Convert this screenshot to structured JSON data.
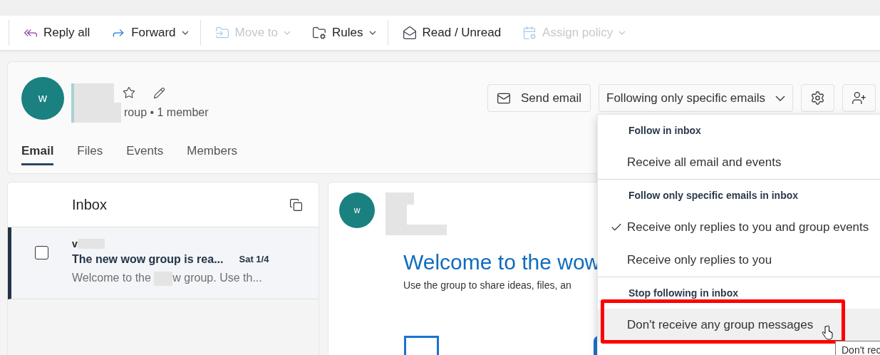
{
  "toolbar": [
    {
      "kind": "reply_all",
      "label": "Reply all",
      "disabled": false,
      "has_menu": false
    },
    {
      "kind": "forward",
      "label": "Forward",
      "disabled": false,
      "has_menu": true
    },
    {
      "kind": "move",
      "label": "Move to",
      "disabled": true,
      "has_menu": true
    },
    {
      "kind": "rules",
      "label": "Rules",
      "disabled": false,
      "has_menu": true
    },
    {
      "kind": "read",
      "label": "Read / Unread",
      "disabled": false,
      "has_menu": false
    },
    {
      "kind": "policy",
      "label": "Assign policy",
      "disabled": true,
      "has_menu": true
    }
  ],
  "group": {
    "avatar": "w",
    "meta": "roup • 1 member",
    "send_button": "Send email",
    "follow_button": "Following only specific emails",
    "tabs": [
      {
        "label": "Email",
        "selected": true
      },
      {
        "label": "Files",
        "selected": false
      },
      {
        "label": "Events",
        "selected": false
      },
      {
        "label": "Members",
        "selected": false
      }
    ]
  },
  "inbox": {
    "title": "Inbox",
    "messages": [
      {
        "sender": "v",
        "subject": "The new wow group is rea...",
        "date": "Sat 1/4",
        "preview_start": "Welcome to the",
        "preview_end": "w group. Use th...",
        "selected": true,
        "checked": false
      }
    ]
  },
  "reading_pane": {
    "avatar": "w",
    "heading": "Welcome to the wow",
    "body": "Use the group to share ideas, files, an"
  },
  "follow_menu": {
    "sections": [
      {
        "header": "Follow in inbox",
        "items": [
          {
            "label": "Receive all email and events",
            "checked": false,
            "highlighted": false
          }
        ]
      },
      {
        "header": "Follow only specific emails in inbox",
        "items": [
          {
            "label": "Receive only replies to you and group events",
            "checked": true,
            "highlighted": false
          },
          {
            "label": "Receive only replies to you",
            "checked": false,
            "highlighted": false
          }
        ]
      },
      {
        "header": "Stop following in inbox",
        "items": [
          {
            "label": "Don't receive any group messages",
            "checked": false,
            "highlighted": true
          }
        ]
      }
    ]
  },
  "tooltip": "Don't rec"
}
